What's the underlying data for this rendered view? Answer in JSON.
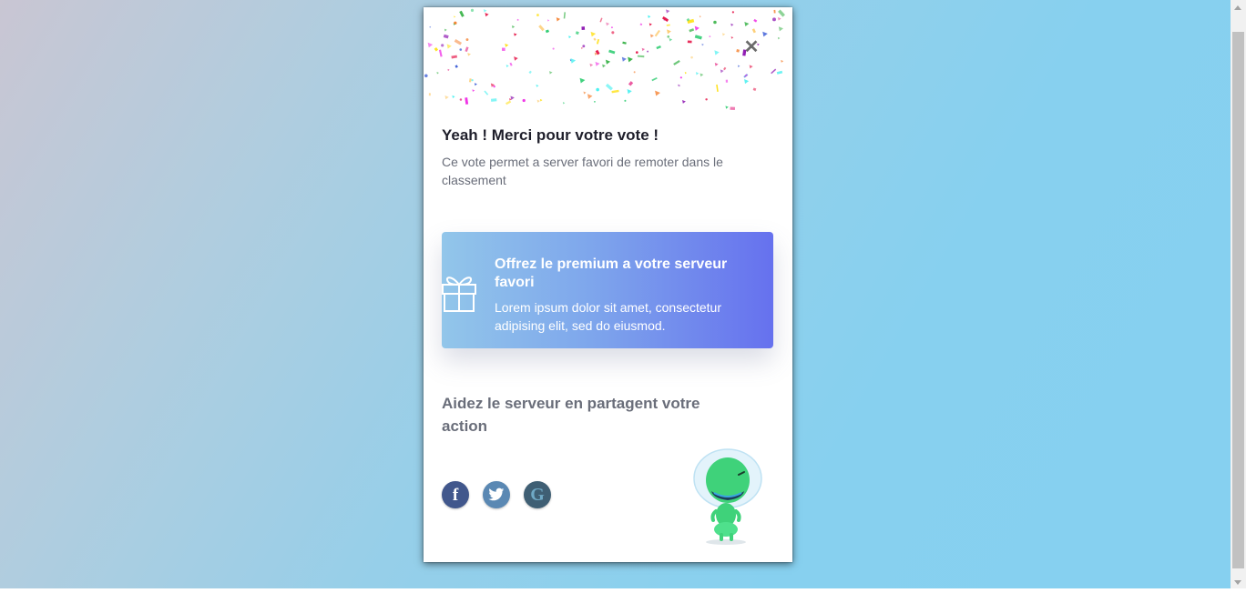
{
  "modal": {
    "close_glyph": "✕",
    "title": "Yeah ! Merci pour votre vote !",
    "subtitle": "Ce vote permet a server favori de remoter dans le classement"
  },
  "premium_card": {
    "title": "Offrez le premium a votre serveur favori",
    "text": "Lorem ipsum dolor sit amet, consectetur adipising elit, sed do eiusmod.",
    "icon": "gift-icon"
  },
  "share": {
    "heading": "Aidez le serveur en partagent votre action",
    "buttons": [
      {
        "network": "facebook",
        "glyph": "f",
        "icon": "facebook-icon"
      },
      {
        "network": "twitter",
        "glyph": "",
        "icon": "twitter-icon"
      },
      {
        "network": "google",
        "glyph": "G",
        "icon": "google-icon"
      }
    ]
  },
  "colors": {
    "card_gradient_start": "#92c6ea",
    "card_gradient_end": "#6671ee",
    "facebook": "#41578c",
    "twitter": "#5a88b3",
    "google": "#3f5f74",
    "mascot": "#3fd27a"
  }
}
